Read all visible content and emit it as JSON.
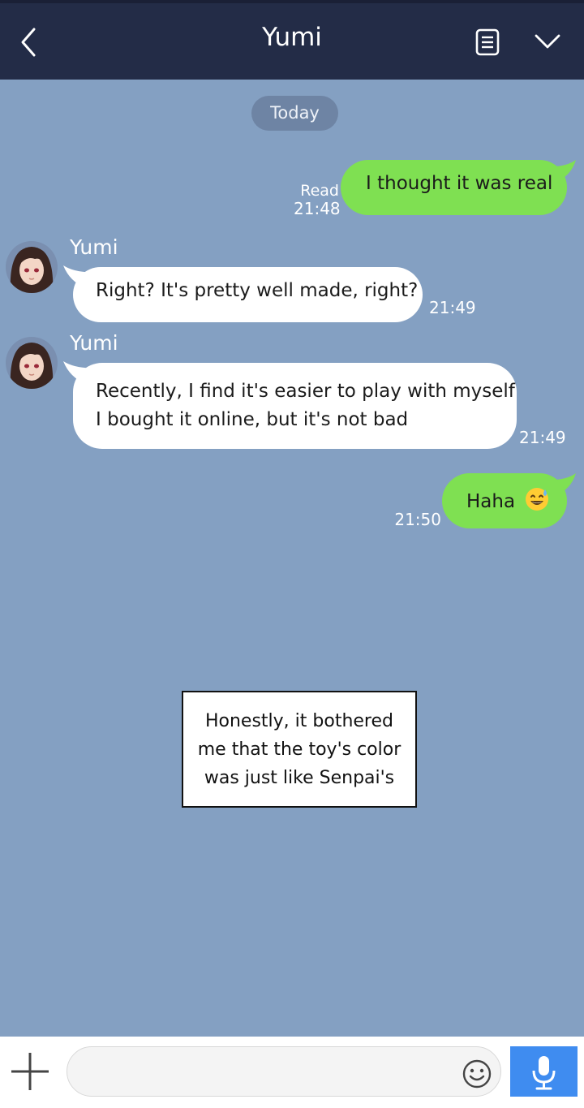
{
  "header": {
    "title": "Yumi",
    "back_icon": "chevron-left-icon",
    "notes_icon": "note-icon",
    "menu_icon": "chevron-down-icon",
    "background": "#232c47"
  },
  "chat": {
    "date_separator": "Today",
    "background": "#84a0c2",
    "messages": [
      {
        "direction": "outgoing",
        "lines": [
          "I thought it was real"
        ],
        "read": "Read",
        "time": "21:48"
      },
      {
        "direction": "incoming",
        "sender": "Yumi",
        "lines": [
          "Right? It's pretty well made, right?"
        ],
        "time": "21:49"
      },
      {
        "direction": "incoming",
        "sender": "Yumi",
        "lines": [
          "Recently, I find it's easier to play with myself",
          "I bought it online, but it's not bad"
        ],
        "time": "21:49"
      },
      {
        "direction": "outgoing",
        "lines": [
          "Haha"
        ],
        "emoji": "grinning-sweat-emoji",
        "time": "21:50"
      }
    ]
  },
  "caption": {
    "lines": [
      "Honestly, it bothered",
      "me that the toy's color",
      "was just like Senpai's"
    ]
  },
  "composer": {
    "value": "",
    "plus_icon": "plus-icon",
    "emoji_icon": "smiley-icon",
    "mic_icon": "microphone-icon",
    "mic_color": "#3f8cf0"
  },
  "colors": {
    "outgoing_bubble": "#7fe052",
    "incoming_bubble": "#ffffff"
  }
}
